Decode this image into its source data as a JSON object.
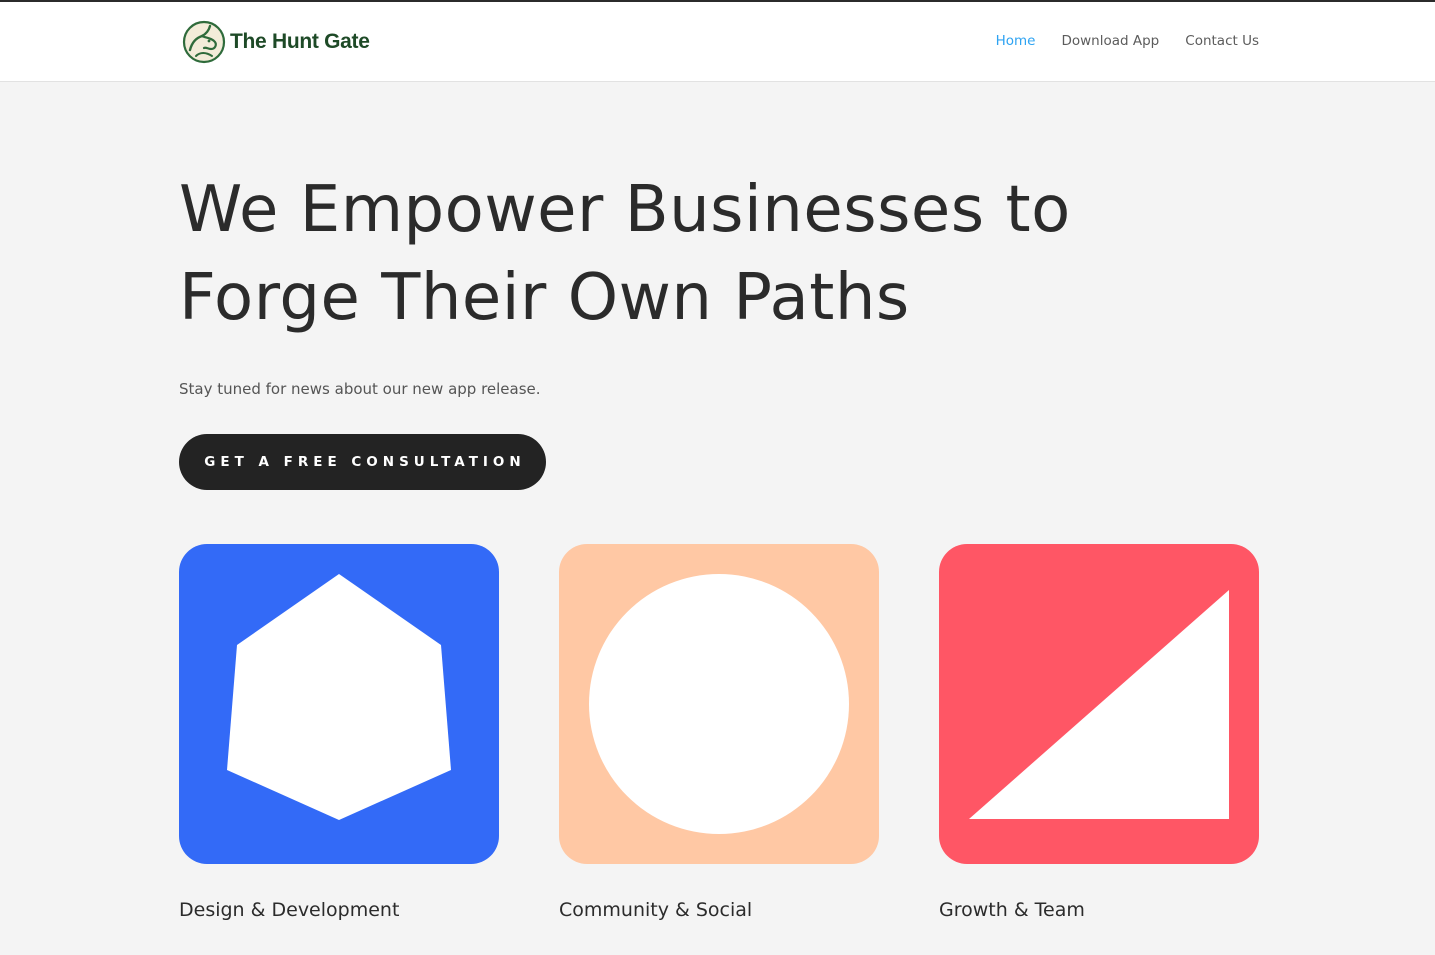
{
  "header": {
    "logo_text": "The Hunt Gate",
    "logo_colors": {
      "ring": "#2f6b3b",
      "fill": "#f3ecd9",
      "text": "#1e4a27"
    },
    "nav": [
      {
        "label": "Home",
        "active": true
      },
      {
        "label": "Download App",
        "active": false
      },
      {
        "label": "Contact Us",
        "active": false
      }
    ],
    "active_color": "#2ea3f2"
  },
  "hero": {
    "title_line1": "We Empower Businesses to",
    "title_line2": "Forge Their Own Paths",
    "subtitle": "Stay tuned for news about our new app release.",
    "cta_label": "Get a Free Consultation"
  },
  "cards": [
    {
      "label": "Design & Development",
      "shape": "hexagon-icon",
      "color": "#336af7"
    },
    {
      "label": "Community & Social",
      "shape": "circle-icon",
      "color": "#ffc8a4"
    },
    {
      "label": "Growth & Team",
      "shape": "triangle-icon",
      "color": "#ff5665"
    }
  ]
}
